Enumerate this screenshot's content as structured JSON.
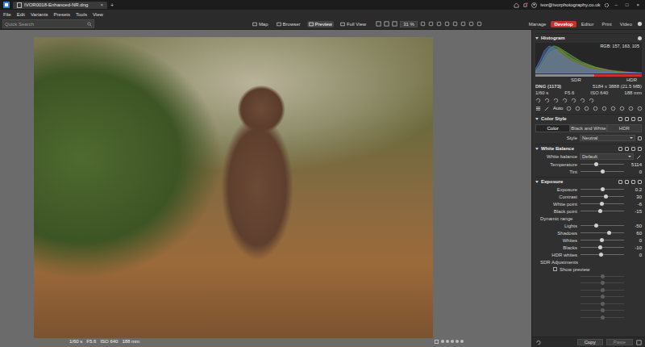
{
  "window": {
    "title": "IVOR0018-Enhanced-NR.dng",
    "close": "×",
    "new_tab": "+",
    "account": "ivor@ivorphotography.co.uk",
    "controls": [
      "–",
      "□",
      "×"
    ]
  },
  "menu": [
    "File",
    "Edit",
    "Variants",
    "Presets",
    "Tools",
    "View"
  ],
  "search": {
    "placeholder": "Quick Search"
  },
  "view_modes": [
    {
      "label": "Map",
      "selected": false
    },
    {
      "label": "Browser",
      "selected": false
    },
    {
      "label": "Preview",
      "selected": true
    },
    {
      "label": "Full View",
      "selected": false
    }
  ],
  "zoom": "31 %",
  "modules": [
    {
      "label": "Manage",
      "selected": false
    },
    {
      "label": "Develop",
      "selected": true
    },
    {
      "label": "Editor",
      "selected": false
    },
    {
      "label": "Print",
      "selected": false
    },
    {
      "label": "Video",
      "selected": false
    }
  ],
  "photo": {
    "exif": [
      "1/60 s",
      "F5.6",
      "ISO 640",
      "188 mm"
    ],
    "stars": 0,
    "max_stars": 5
  },
  "histogram": {
    "title": "Histogram",
    "rgb": "RGB: 157, 163, 105",
    "sdr": "SDR",
    "hdr": "HDR",
    "hdr_level": 0.45,
    "series": [
      {
        "name": "red",
        "color": "#d04a3a",
        "values": [
          5,
          20,
          45,
          70,
          80,
          85,
          75,
          60,
          50,
          42,
          35,
          30,
          25,
          20,
          18,
          15,
          12,
          10,
          8,
          6,
          5,
          4,
          3,
          2
        ]
      },
      {
        "name": "green",
        "color": "#5cc04a",
        "values": [
          8,
          30,
          60,
          85,
          95,
          90,
          80,
          70,
          60,
          50,
          40,
          34,
          28,
          22,
          18,
          14,
          10,
          8,
          6,
          5,
          4,
          3,
          2,
          1
        ]
      },
      {
        "name": "blue",
        "color": "#5a78e0",
        "values": [
          15,
          45,
          80,
          95,
          88,
          75,
          62,
          50,
          40,
          32,
          26,
          20,
          15,
          12,
          10,
          8,
          6,
          5,
          4,
          3,
          2,
          2,
          1,
          1
        ]
      }
    ]
  },
  "file_info": {
    "format": "DNG (1173)",
    "size": "5184 x 3888 (21.5 MB)",
    "exif": [
      "1/60 s",
      "F5.6",
      "ISO 640",
      "188 mm"
    ]
  },
  "auto": "Auto",
  "color_style": {
    "title": "Color Style",
    "expanded": true,
    "modes": [
      {
        "label": "Color",
        "selected": true
      },
      {
        "label": "Black and White",
        "selected": false
      },
      {
        "label": "HDR",
        "selected": false
      }
    ],
    "style_label": "Style",
    "style_value": "Neutral"
  },
  "white_balance": {
    "title": "White Balance",
    "expanded": true,
    "label": "White balance",
    "value": "Default",
    "sliders": [
      {
        "name": "Temperature",
        "value": "5114",
        "level": 0.37
      },
      {
        "name": "Tint",
        "value": "0",
        "level": 0.5
      }
    ]
  },
  "exposure": {
    "title": "Exposure",
    "expanded": true,
    "sliders": [
      {
        "name": "Exposure",
        "value": "0.2",
        "level": 0.51
      },
      {
        "name": "Contrast",
        "value": "30",
        "level": 0.58
      },
      {
        "name": "White point",
        "value": "-6",
        "level": 0.49
      },
      {
        "name": "Black point",
        "value": "-15",
        "level": 0.46
      }
    ],
    "dynamic_range": "Dynamic range",
    "range_sliders": [
      {
        "name": "Lights",
        "value": "-50",
        "level": 0.37
      },
      {
        "name": "Shadows",
        "value": "60",
        "level": 0.65
      },
      {
        "name": "Whites",
        "value": "0",
        "level": 0.49
      },
      {
        "name": "Blacks",
        "value": "-10",
        "level": 0.45
      },
      {
        "name": "HDR whites",
        "value": "0",
        "level": 0.48
      }
    ],
    "sdr_title": "SDR Adjustments",
    "show_preview": {
      "label": "Show preview",
      "checked": false
    },
    "sdr_sliders": [
      {
        "disabled": true,
        "level": 0.5
      },
      {
        "disabled": true,
        "level": 0.5
      },
      {
        "disabled": true,
        "level": 0.5
      },
      {
        "disabled": true,
        "level": 0.5
      },
      {
        "disabled": true,
        "level": 0.5
      },
      {
        "disabled": true,
        "level": 0.5
      },
      {
        "disabled": true,
        "level": 0.5
      }
    ]
  },
  "footer": {
    "copy": "Copy",
    "paste": "Paste",
    "paste_disabled": true
  }
}
